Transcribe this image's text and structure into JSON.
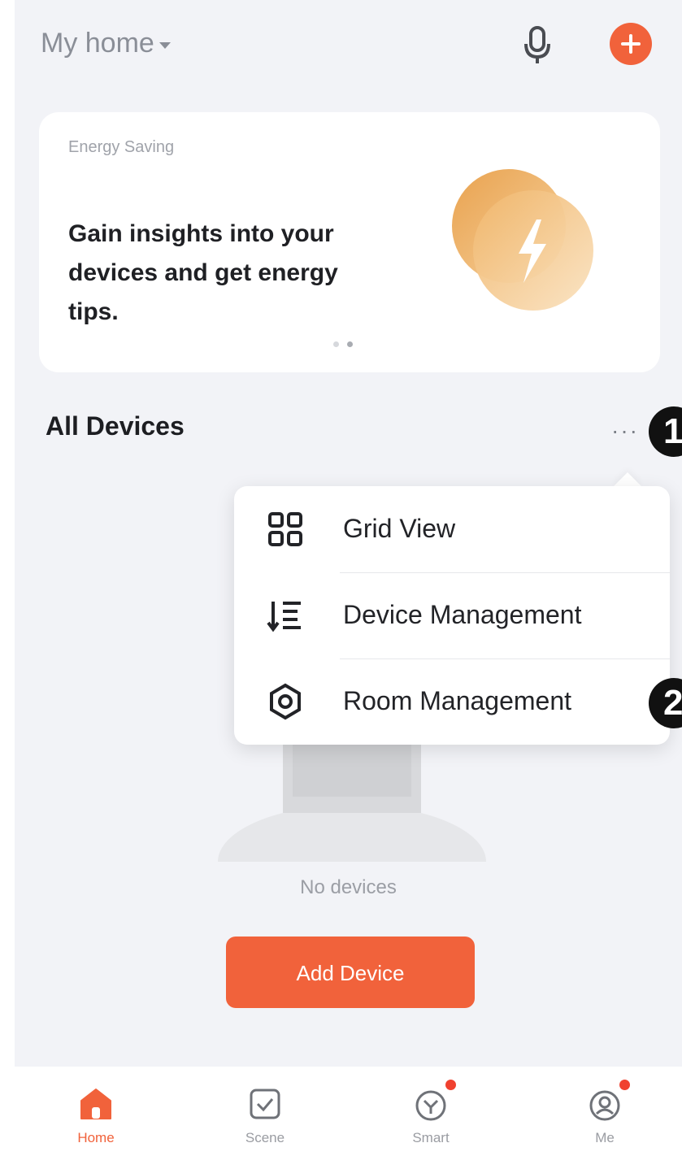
{
  "header": {
    "home_name": "My home",
    "mic_icon": "microphone-icon",
    "add_icon": "plus-circle-icon"
  },
  "energy_card": {
    "label": "Energy Saving",
    "text": "Gain insights into your devices and get energy tips.",
    "icon": "lightning-bolt-icon",
    "carousel_pages": 2,
    "carousel_active_index": 1
  },
  "devices_section": {
    "title": "All Devices",
    "more_label": "···"
  },
  "menu": {
    "items": [
      {
        "label": "Grid View",
        "icon": "grid-view-icon"
      },
      {
        "label": "Device Management",
        "icon": "device-list-icon"
      },
      {
        "label": "Room Management",
        "icon": "room-settings-icon"
      }
    ]
  },
  "callouts": [
    "1",
    "2"
  ],
  "empty_state": {
    "text": "No devices",
    "button_label": "Add Device"
  },
  "bottom_nav": {
    "items": [
      {
        "label": "Home",
        "icon": "home-icon",
        "active": true
      },
      {
        "label": "Scene",
        "icon": "scene-icon",
        "active": false
      },
      {
        "label": "Smart",
        "icon": "smart-icon",
        "active": false
      },
      {
        "label": "Me",
        "icon": "profile-icon",
        "active": false
      }
    ]
  },
  "colors": {
    "accent": "#f1623b",
    "background": "#f2f3f7",
    "notification_dot": "#f0412f"
  }
}
